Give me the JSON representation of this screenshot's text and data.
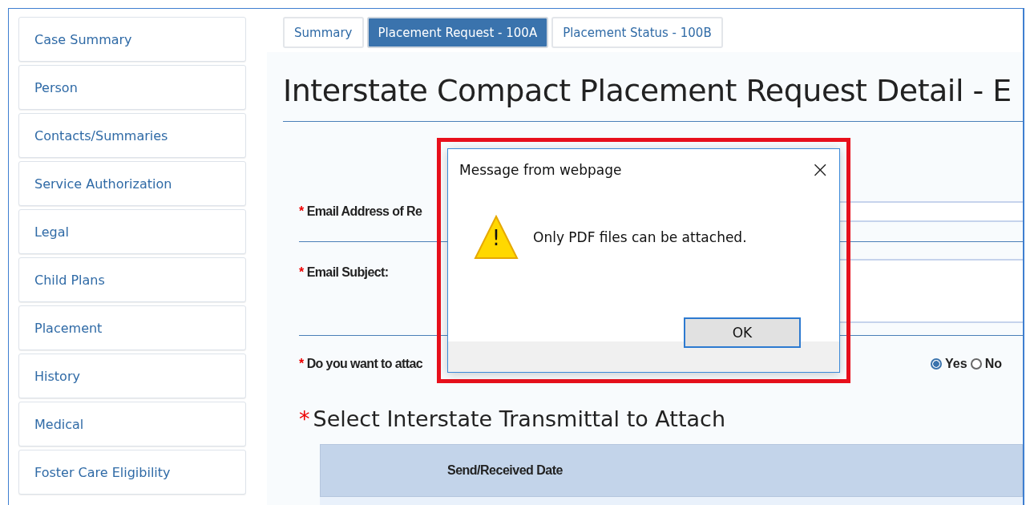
{
  "sidebar": {
    "items": [
      {
        "label": "Case Summary"
      },
      {
        "label": "Person"
      },
      {
        "label": "Contacts/Summaries"
      },
      {
        "label": "Service Authorization"
      },
      {
        "label": "Legal"
      },
      {
        "label": "Child Plans"
      },
      {
        "label": "Placement"
      },
      {
        "label": "History"
      },
      {
        "label": "Medical"
      },
      {
        "label": "Foster Care Eligibility"
      }
    ]
  },
  "tabs": [
    {
      "label": "Summary",
      "selected": false
    },
    {
      "label": "Placement Request - 100A",
      "selected": true
    },
    {
      "label": "Placement Status - 100B",
      "selected": false
    }
  ],
  "page_title": "Interstate Compact Placement Request Detail - E",
  "form": {
    "fields": [
      {
        "kind": "input",
        "label": "Email Address of Re",
        "required_mark": "*"
      },
      {
        "kind": "textarea",
        "label": "Email Subject:",
        "required_mark": "*"
      },
      {
        "kind": "radio",
        "label": "Do you want to attac",
        "required_mark": "*",
        "options": [
          {
            "label": "Yes",
            "selected": true
          },
          {
            "label": "No",
            "selected": false
          }
        ]
      }
    ]
  },
  "section": {
    "title": "Select Interstate Transmittal to Attach",
    "required_mark": "*"
  },
  "table": {
    "columns": [
      "Send/Received Date"
    ]
  },
  "dialog": {
    "title": "Message from webpage",
    "close": "×",
    "message": "Only PDF files can be attached.",
    "icon": "!",
    "button": "OK",
    "highlighted": true
  }
}
